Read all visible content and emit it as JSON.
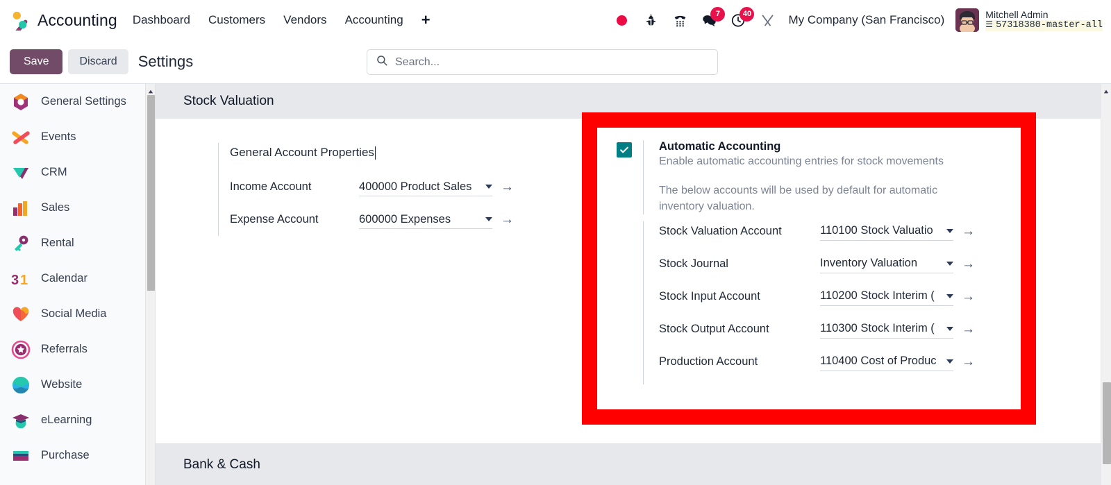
{
  "navbar": {
    "brand": "Accounting",
    "brand_logo_icon": "accounting-app-logo",
    "links": [
      {
        "label": "Dashboard"
      },
      {
        "label": "Customers"
      },
      {
        "label": "Vendors"
      },
      {
        "label": "Accounting"
      }
    ],
    "plus_label": "+",
    "sys_icons": [
      {
        "name": "recording-dot-icon",
        "badge": ""
      },
      {
        "name": "bug-icon",
        "badge": ""
      },
      {
        "name": "phone-dialpad-icon",
        "badge": ""
      },
      {
        "name": "messages-icon",
        "badge": "7"
      },
      {
        "name": "activities-clock-icon",
        "badge": "40"
      },
      {
        "name": "tools-wrench-icon",
        "badge": ""
      }
    ],
    "company": "My Company (San Francisco)",
    "user_name": "Mitchell Admin",
    "user_db": "57318380-master-all",
    "avatar_icon": "user-avatar"
  },
  "control_panel": {
    "save_label": "Save",
    "discard_label": "Discard",
    "title": "Settings",
    "search_placeholder": "Search...",
    "search_value": "",
    "search_icon": "search-icon"
  },
  "sidebar": {
    "items": [
      {
        "label": "General Settings",
        "icon": "settings-app-icon"
      },
      {
        "label": "Events",
        "icon": "events-app-icon"
      },
      {
        "label": "CRM",
        "icon": "crm-app-icon"
      },
      {
        "label": "Sales",
        "icon": "sales-app-icon"
      },
      {
        "label": "Rental",
        "icon": "rental-key-icon"
      },
      {
        "label": "Calendar",
        "icon": "calendar-31-icon"
      },
      {
        "label": "Social Media",
        "icon": "social-heart-icon"
      },
      {
        "label": "Referrals",
        "icon": "referrals-star-icon"
      },
      {
        "label": "Website",
        "icon": "website-globe-icon"
      },
      {
        "label": "eLearning",
        "icon": "elearning-cap-icon"
      },
      {
        "label": "Purchase",
        "icon": "purchase-app-icon"
      }
    ]
  },
  "main": {
    "section_title": "Stock Valuation",
    "bottom_section_title": "Bank & Cash",
    "general_account_properties": {
      "title": "General Account Properties",
      "fields": [
        {
          "label": "Income Account",
          "value": "400000 Product Sales"
        },
        {
          "label": "Expense Account",
          "value": "600000 Expenses"
        }
      ]
    },
    "automatic_accounting": {
      "checked": true,
      "title": "Automatic Accounting",
      "subtitle": "Enable automatic accounting entries for stock movements",
      "note": "The below accounts will be used by default for automatic inventory valuation.",
      "fields": [
        {
          "label": "Stock Valuation Account",
          "value": "110100 Stock Valuatio"
        },
        {
          "label": "Stock Journal",
          "value": "Inventory Valuation"
        },
        {
          "label": "Stock Input Account",
          "value": "110200 Stock Interim ("
        },
        {
          "label": "Stock Output Account",
          "value": "110300 Stock Interim ("
        },
        {
          "label": "Production Account",
          "value": "110400 Cost of Produc"
        }
      ]
    },
    "highlight_color": "#ff0000"
  },
  "colors": {
    "brand_purple": "#714b67",
    "checkbox_teal": "#017e84",
    "badge_red": "#e8114b",
    "highlight_red": "#ff0000"
  }
}
